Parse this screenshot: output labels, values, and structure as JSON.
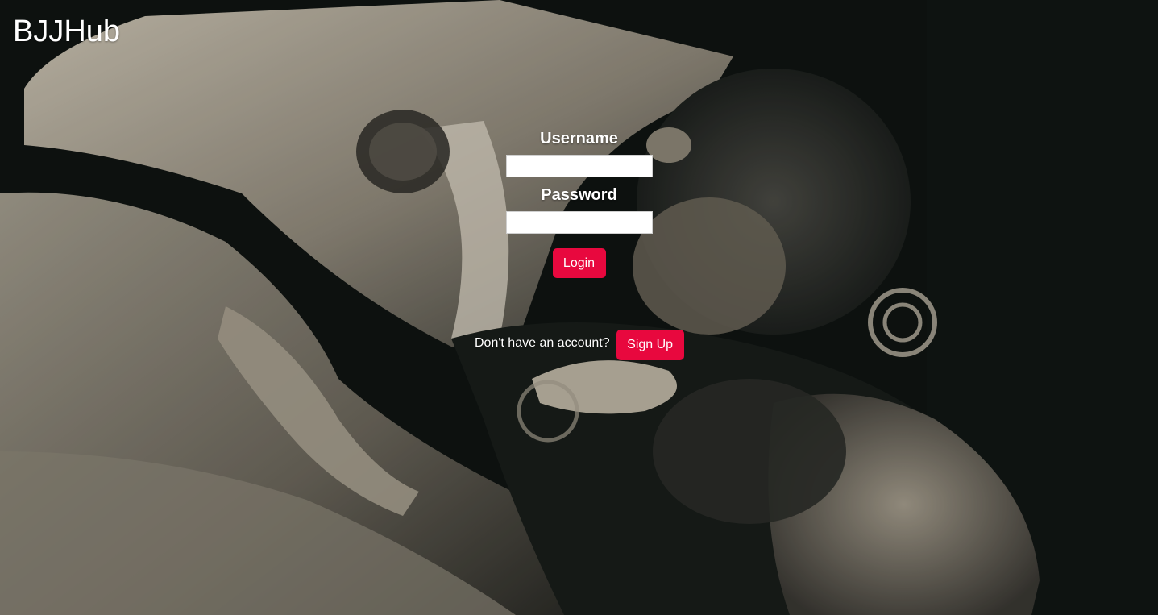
{
  "brand": {
    "title": "BJJHub"
  },
  "login_form": {
    "username_label": "Username",
    "username_value": "",
    "password_label": "Password",
    "password_value": "",
    "login_label": "Login"
  },
  "signup": {
    "prompt": "Don't have an account?",
    "button_label": "Sign Up"
  },
  "colors": {
    "accent": "#e8083e",
    "text": "#ffffff",
    "background": "#0d1210"
  }
}
